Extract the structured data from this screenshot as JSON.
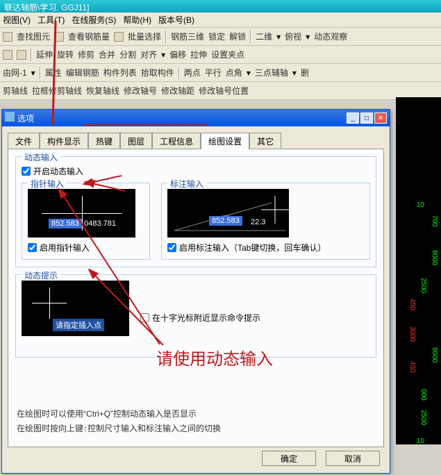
{
  "title": "联达轴筋\\学习. GGJ11]",
  "menu": [
    "视图(V)",
    "工具(T)",
    "在线服务(S)",
    "帮助(H)",
    "版本号(B)"
  ],
  "tb1": {
    "a": "查找图元",
    "b": "查看钢筋量",
    "c": "批量选择",
    "d": "钢筋三维",
    "e": "锁定",
    "f": "解锁",
    "g": "二维",
    "h": "俯视",
    "i": "动态观察"
  },
  "tb2": {
    "a": "延伸",
    "b": "旋转",
    "c": "修剪",
    "d": "合并",
    "e": "分割",
    "f": "对齐",
    "g": "偏移",
    "h": "拉伸",
    "i": "设置夹点"
  },
  "tb3": {
    "net": "由网-1",
    "a": "属性",
    "b": "编辑钢筋",
    "c": "构件列表",
    "d": "拾取构件",
    "e": "两点",
    "f": "平行",
    "g": "点角",
    "h": "三点辅轴",
    "i": "删"
  },
  "tb4": {
    "a": "剪轴线",
    "b": "拉框修剪轴线",
    "c": "恢复轴线",
    "d": "修改轴号",
    "e": "修改轴距",
    "f": "修改轴号位置"
  },
  "dialog": {
    "title": "选项",
    "tabs": [
      "文件",
      "构件显示",
      "热键",
      "图层",
      "工程信息",
      "绘图设置",
      "其它"
    ],
    "active": 5,
    "grp_dyn": "动态输入",
    "chk_open": "开启动态输入",
    "grp_ptr": "指针输入",
    "ptr_val1": "852.583",
    "ptr_val2": "0483.781",
    "chk_ptr": "启用指针输入",
    "grp_dim": "标注输入",
    "dim_val1": "852.583",
    "dim_val2": "22.3",
    "chk_dim": "启用标注输入（Tab键切换，回车确认）",
    "grp_hint": "动态提示",
    "hint_box": "请指定插入点",
    "chk_hint": "在十字光标附近显示命令提示",
    "note1": "在绘图时可以使用“Ctrl+Q”控制动态输入是否显示",
    "note2": "在绘图时按向上键↑控制尺寸输入和标注输入之间的切换",
    "ok": "确定",
    "cancel": "取消"
  },
  "annot": "请使用动态输入",
  "dims": {
    "a": "10",
    "b": "700",
    "c": "8000",
    "d": "2500",
    "e": "450",
    "f": "3000",
    "g": "8000",
    "h": "450",
    "i": "000",
    "j": "2500",
    "k": "10"
  }
}
